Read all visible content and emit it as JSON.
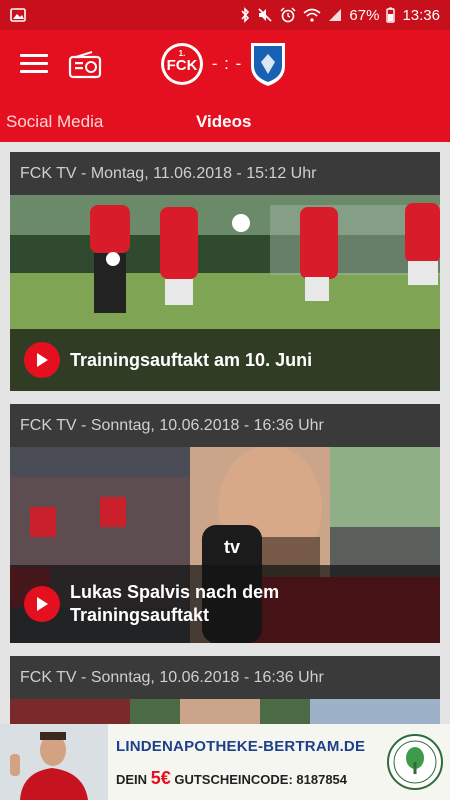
{
  "status_bar": {
    "battery": "67%",
    "time": "13:36"
  },
  "match": {
    "score": "- : -"
  },
  "tabs": [
    {
      "label": "Social Media"
    },
    {
      "label": "Videos"
    }
  ],
  "videos": [
    {
      "header": "FCK TV - Montag, 11.06.2018 - 15:12 Uhr",
      "title": "Trainingsauftakt am 10. Juni"
    },
    {
      "header": "FCK TV - Sonntag, 10.06.2018 - 16:36 Uhr",
      "title": "Lukas Spalvis nach dem Trainingsauftakt"
    },
    {
      "header": "FCK TV - Sonntag, 10.06.2018 - 16:36 Uhr",
      "title": ""
    }
  ],
  "ad": {
    "url": "LINDENAPOTHEKE-BERTRAM.DE",
    "line_prefix": "DEIN",
    "amount": "5€",
    "line_suffix": "GUTSCHEINCODE: 8187854"
  },
  "colors": {
    "brand_red": "#e5101f",
    "status_red": "#c80f1c",
    "card_header": "#3a3a3a"
  }
}
